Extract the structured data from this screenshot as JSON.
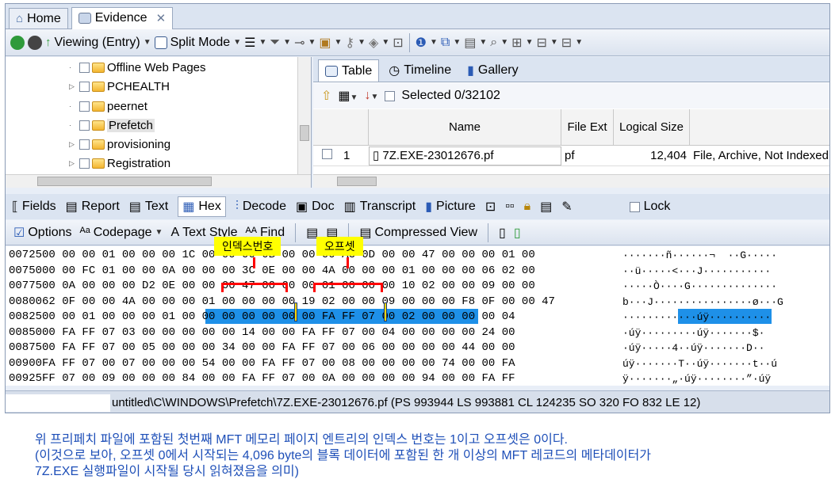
{
  "tabs": [
    {
      "label": "Home"
    },
    {
      "label": "Evidence"
    }
  ],
  "toolbar": {
    "viewing": "Viewing (Entry)",
    "split": "Split Mode"
  },
  "tree": {
    "items": [
      {
        "label": "Offline Web Pages",
        "expandable": false
      },
      {
        "label": "PCHEALTH",
        "expandable": true
      },
      {
        "label": "peernet",
        "expandable": false
      },
      {
        "label": "Prefetch",
        "expandable": false,
        "selected": true
      },
      {
        "label": "provisioning",
        "expandable": true
      },
      {
        "label": "Registration",
        "expandable": true
      }
    ]
  },
  "view_tabs": [
    {
      "label": "Table"
    },
    {
      "label": "Timeline"
    },
    {
      "label": "Gallery"
    }
  ],
  "selected_text": "Selected 0/32102",
  "table": {
    "headers": {
      "name": "Name",
      "ext": "File Ext",
      "logical": "Logical Size"
    },
    "rows": [
      {
        "num": "1",
        "name": "7Z.EXE-23012676.pf",
        "ext": "pf",
        "size": "12,404",
        "desc": "File, Archive, Not Indexed"
      }
    ]
  },
  "panel_tabs": [
    {
      "label": "Fields"
    },
    {
      "label": "Report"
    },
    {
      "label": "Text"
    },
    {
      "label": "Hex"
    },
    {
      "label": "Decode"
    },
    {
      "label": "Doc"
    },
    {
      "label": "Transcript"
    },
    {
      "label": "Picture"
    }
  ],
  "lock_label": "Lock",
  "hex_tools": {
    "options": "Options",
    "codepage": "Codepage",
    "text_style": "Text Style",
    "find": "Find",
    "compressed": "Compressed View"
  },
  "hex": {
    "lines": [
      {
        "off": "00725",
        "bytes": "00 00 00 01 00 00 00 1C 00 00 00 0B 00 00 00 AC 0D 00 00 47 00 00 00 01 00",
        "ascii": "·······ñ······¬  ··G·····"
      },
      {
        "off": "00750",
        "bytes": "00 00 FC 01 00 00 0A 00 00 00 3C 0E 00 00 4A 00 00 00 01 00 00 00 06 02 00",
        "ascii": "··ü·····<···J···········"
      },
      {
        "off": "00775",
        "bytes": "00 0A 00 00 00 D2 0E 00 00 00 47 00 00 00 01 00 00 00 10 02 00 00 09 00 00",
        "ascii": "·····Ò····G··············"
      },
      {
        "off": "00800",
        "bytes": "62 0F 00 00 4A 00 00 00 01 00 00 00 00 19 02 00 00 09 00 00 00 F8 0F 00 00 47",
        "ascii": "b···J················ø···G"
      },
      {
        "off": "00825",
        "bytes": "00 00 01 00 00 00 01 00 00 00 00 00 00 00 FA FF 07 00 02 00 00 00 00 04",
        "ascii": "············úÿ··········"
      },
      {
        "off": "00850",
        "bytes": "00 FA FF 07 03 00 00 00 00 00 14 00 00 FA FF 07 00 04 00 00 00 00 24 00",
        "ascii": "·úÿ·········úÿ·······$·"
      },
      {
        "off": "00875",
        "bytes": "00 FA FF 07 00 05 00 00 00 34 00 00 FA FF 07 00 06 00 00 00 00 44 00 00",
        "ascii": "·úÿ·····4··úÿ·······D··"
      },
      {
        "off": "00900",
        "bytes": "FA FF 07 00 07 00 00 00 54 00 00 FA FF 07 00 08 00 00 00 00 74 00 00 FA",
        "ascii": "úÿ·······T··úÿ·······t··ú"
      },
      {
        "off": "00925",
        "bytes": "FF 07 00 09 00 00 00 84 00 00 FA FF 07 00 0A 00 00 00 00 94 00 00 FA FF",
        "ascii": "ÿ·······„·úÿ········”·úÿ"
      }
    ]
  },
  "callouts": {
    "index": "인덱스번호",
    "offset": "오프셋"
  },
  "status_path": "untitled\\C\\WINDOWS\\Prefetch\\7Z.EXE-23012676.pf (PS 993944 LS 993881 CL 124235 SO 320 FO 832 LE 12)",
  "caption": {
    "line1": "위 프리페치 파일에 포함된 첫번째 MFT 메모리 페이지 엔트리의 인덱스 번호는 1이고 오프셋은 0이다.",
    "line2": "(이것으로 보아, 오프셋 0에서 시작되는 4,096 byte의 블록 데이터에 포함된 한 개 이상의 MFT 레코드의 메타데이터가",
    "line3": "7Z.EXE 실행파일이 시작될 당시 읽혀졌음을 의미)"
  },
  "colors": {
    "highlight": "#1e90e8",
    "callout": "#ffff00",
    "bracket": "#ff0000",
    "caption": "#1e4fb8"
  }
}
